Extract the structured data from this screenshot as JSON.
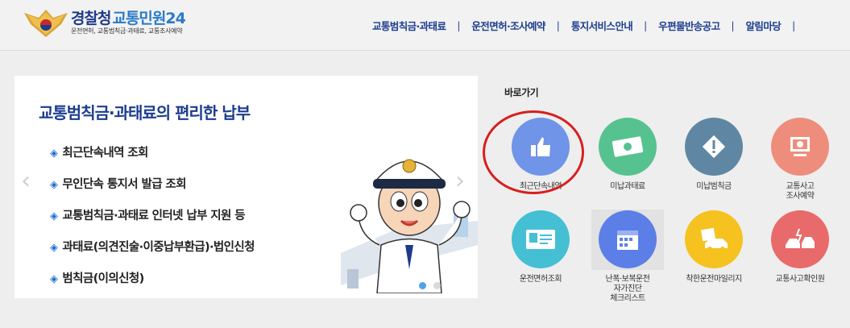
{
  "header": {
    "logo_main": "경찰청",
    "logo_sub_brand": "교통민원24",
    "logo_tagline": "운전면허, 교통범칙금·과태료, 교통조사예약"
  },
  "nav": [
    "교통범칙금·과태료",
    "운전면허·조사예약",
    "통지서비스안내",
    "우편물반송공고",
    "알림마당"
  ],
  "nav_separator": "|",
  "banner": {
    "title": "교통범칙금·과태료의 편리한 납부",
    "items": [
      "최근단속내역 조회",
      "무인단속 통지서 발급 조회",
      "교통범칙금·과태료 인터넷 납부 지원 등",
      "과태료(의견진술·이중납부환급)·법인신청",
      "범칙금(이의신청)"
    ],
    "bullet": "◈",
    "prev": "‹",
    "next": "›"
  },
  "quick": {
    "title": "바로가기",
    "tiles": [
      {
        "label": "최근단속내역",
        "icon": "thumbs-up-icon",
        "color": "#6f94e8"
      },
      {
        "label": "미납과태료",
        "icon": "money-icon",
        "color": "#56c28f"
      },
      {
        "label": "미납범칙금",
        "icon": "warning-sign-icon",
        "color": "#5f87a3"
      },
      {
        "label": "교통사고\n조사예약",
        "icon": "monitor-icon",
        "color": "#ee8d7c"
      },
      {
        "label": "운전면허조회",
        "icon": "license-card-icon",
        "color": "#45bfd4"
      },
      {
        "label": "난폭·보복운전\n자가진단\n체크리스트",
        "icon": "calendar-check-icon",
        "color": "#5b7fe6"
      },
      {
        "label": "착한운전마일리지",
        "icon": "mileage-car-icon",
        "color": "#f5c21f"
      },
      {
        "label": "교통사고확인원",
        "icon": "car-crash-icon",
        "color": "#e96a6a"
      }
    ]
  },
  "colors": {
    "nav": "#1c3d8e",
    "highlight": "#d81e1e",
    "pager_active": "#4aa3e8"
  }
}
